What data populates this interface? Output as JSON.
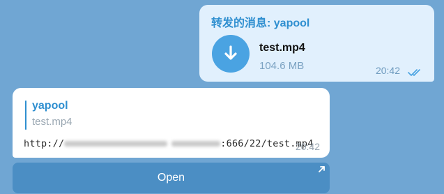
{
  "outgoing": {
    "forward_header": "转发的消息: yapool",
    "file_name": "test.mp4",
    "file_size": "104.6 MB",
    "time": "20:42",
    "download_icon": "download-arrow-icon",
    "status_icon": "double-check-icon"
  },
  "incoming": {
    "reply_author": "yapool",
    "reply_text": "test.mp4",
    "url_prefix": "http://",
    "url_suffix": ":666/22/test.mp4",
    "time": "20:42"
  },
  "inline_button": {
    "label": "Open",
    "icon": "external-arrow-icon"
  },
  "colors": {
    "background": "#70a6d3",
    "outgoing_bubble": "#e1f0fd",
    "accent": "#2f8fd0",
    "button": "#4b8ec4"
  }
}
